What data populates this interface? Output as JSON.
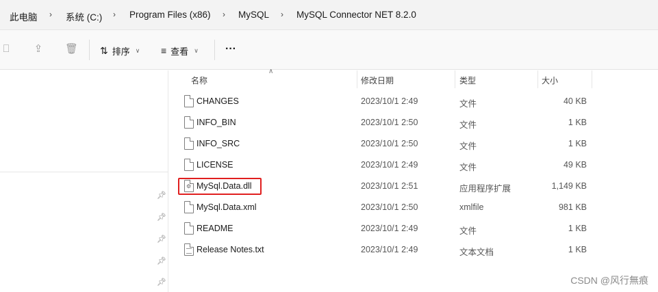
{
  "breadcrumb": [
    "此电脑",
    "系统 (C:)",
    "Program Files (x86)",
    "MySQL",
    "MySQL Connector NET 8.2.0"
  ],
  "toolbar": {
    "sort_label": "排序",
    "view_label": "查看",
    "more_label": "···"
  },
  "columns": {
    "name": "名称",
    "date": "修改日期",
    "type": "类型",
    "size": "大小"
  },
  "files": [
    {
      "name": "CHANGES",
      "date": "2023/10/1 2:49",
      "type": "文件",
      "size": "40 KB",
      "icon": "file-icon"
    },
    {
      "name": "INFO_BIN",
      "date": "2023/10/1 2:50",
      "type": "文件",
      "size": "1 KB",
      "icon": "file-icon"
    },
    {
      "name": "INFO_SRC",
      "date": "2023/10/1 2:50",
      "type": "文件",
      "size": "1 KB",
      "icon": "file-icon"
    },
    {
      "name": "LICENSE",
      "date": "2023/10/1 2:49",
      "type": "文件",
      "size": "49 KB",
      "icon": "file-icon"
    },
    {
      "name": "MySql.Data.dll",
      "date": "2023/10/1 2:51",
      "type": "应用程序扩展",
      "size": "1,149 KB",
      "icon": "dll-icon",
      "highlighted": true
    },
    {
      "name": "MySql.Data.xml",
      "date": "2023/10/1 2:50",
      "type": "xmlfile",
      "size": "981 KB",
      "icon": "file-icon"
    },
    {
      "name": "README",
      "date": "2023/10/1 2:49",
      "type": "文件",
      "size": "1 KB",
      "icon": "file-icon"
    },
    {
      "name": "Release Notes.txt",
      "date": "2023/10/1 2:49",
      "type": "文本文档",
      "size": "1 KB",
      "icon": "text-file-icon"
    }
  ],
  "watermark": "CSDN @风行無痕",
  "colors": {
    "highlight": "#e01e1e"
  }
}
